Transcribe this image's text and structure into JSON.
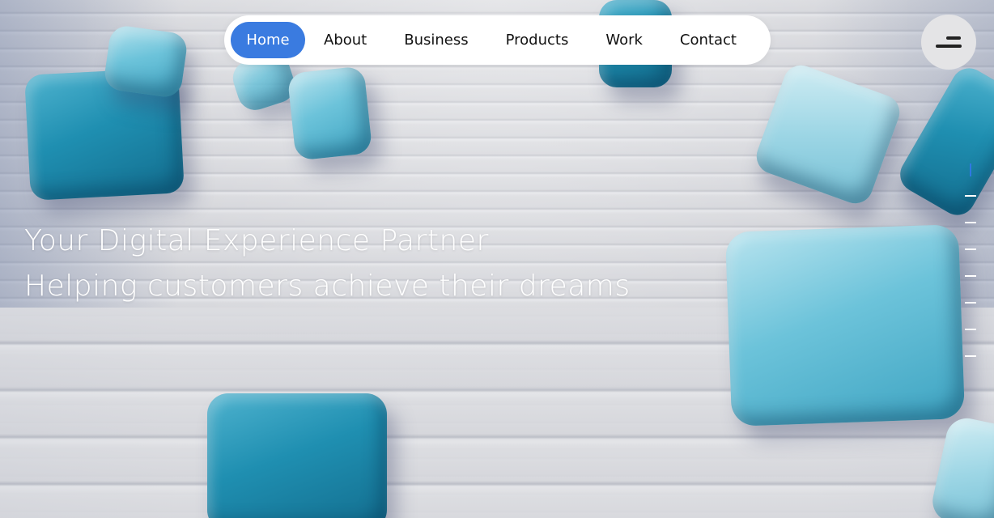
{
  "nav": {
    "items": [
      {
        "label": "Home",
        "active": true
      },
      {
        "label": "About",
        "active": false
      },
      {
        "label": "Business",
        "active": false
      },
      {
        "label": "Products",
        "active": false
      },
      {
        "label": "Work",
        "active": false
      },
      {
        "label": "Contact",
        "active": false
      }
    ]
  },
  "menu_button": {
    "icon": "menu-icon"
  },
  "hero": {
    "headline": "Your Digital Experience Partner",
    "subheadline": "Helping customers achieve their dreams"
  },
  "pager": {
    "total": 8,
    "current": 1
  },
  "colors": {
    "accent": "#3a7be0",
    "cube": "#1f8fb1"
  }
}
